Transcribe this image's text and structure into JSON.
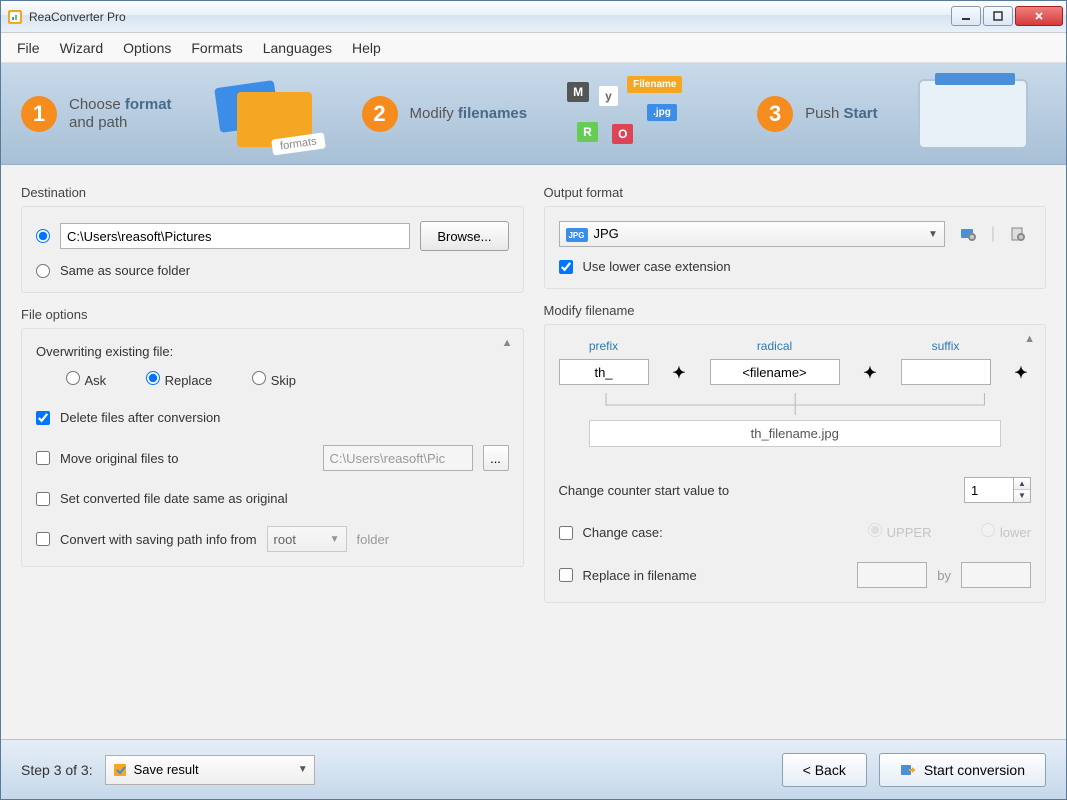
{
  "window": {
    "title": "ReaConverter Pro"
  },
  "menu": {
    "file": "File",
    "wizard": "Wizard",
    "options": "Options",
    "formats": "Formats",
    "languages": "Languages",
    "help": "Help"
  },
  "steps": {
    "s1a": "Choose ",
    "s1b": "format",
    "s1c": "and path",
    "s2a": "Modify ",
    "s2b": "filenames",
    "s3a": "Push ",
    "s3b": "Start",
    "folder_tag": "formats",
    "tile_m": "M",
    "tile_y": "y",
    "tile_fn": "Filename",
    "tile_jpg": ".jpg",
    "tile_r": "R",
    "tile_o": "O"
  },
  "dest": {
    "heading": "Destination",
    "path": "C:\\Users\\reasoft\\Pictures",
    "browse": "Browse...",
    "same": "Same as source folder"
  },
  "fopt": {
    "heading": "File options",
    "overwrite_label": "Overwriting existing file:",
    "ask": "Ask",
    "replace": "Replace",
    "skip": "Skip",
    "delete_after": "Delete files after conversion",
    "move_orig": "Move original files to",
    "move_path": "C:\\Users\\reasoft\\Pic",
    "set_date": "Set converted file date same as original",
    "convert_path": "Convert with saving path info from",
    "root": "root",
    "folder_word": "folder"
  },
  "out": {
    "heading": "Output format",
    "format": "JPG",
    "lowercase": "Use lower case extension"
  },
  "mod": {
    "heading": "Modify filename",
    "prefix_lbl": "prefix",
    "radical_lbl": "radical",
    "suffix_lbl": "suffix",
    "prefix_val": "th_",
    "radical_val": "<filename>",
    "suffix_val": "",
    "preview": "th_filename.jpg",
    "counter_label": "Change counter start value to",
    "counter_val": "1",
    "change_case": "Change case:",
    "upper": "UPPER",
    "lower": "lower",
    "replace_in": "Replace in filename",
    "by": "by"
  },
  "bottom": {
    "step": "Step 3 of 3:",
    "save": "Save result",
    "back": "< Back",
    "start": "Start conversion"
  }
}
